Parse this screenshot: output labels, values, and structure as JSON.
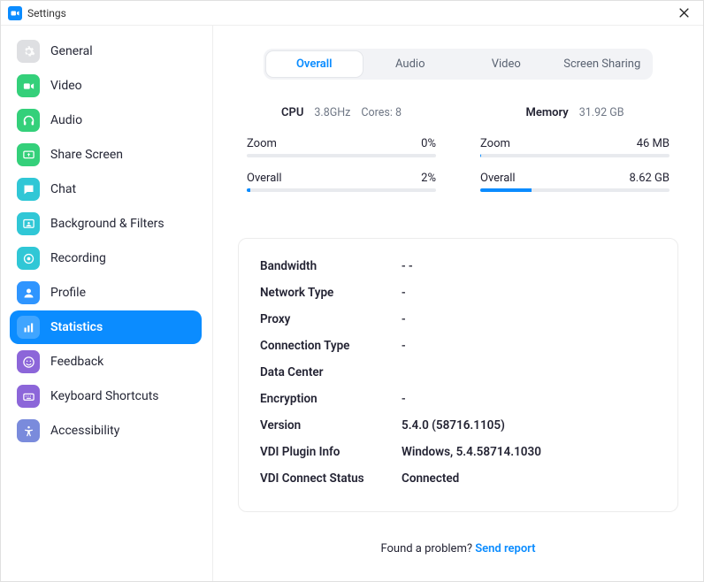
{
  "window": {
    "title": "Settings"
  },
  "sidebar": {
    "items": [
      {
        "id": "general",
        "label": "General",
        "icon": "gear-icon",
        "bg": "#dedfe2"
      },
      {
        "id": "video",
        "label": "Video",
        "icon": "video-icon",
        "bg": "#34d07a"
      },
      {
        "id": "audio",
        "label": "Audio",
        "icon": "headphones-icon",
        "bg": "#34d07a"
      },
      {
        "id": "share-screen",
        "label": "Share Screen",
        "icon": "share-screen-icon",
        "bg": "#34d07a"
      },
      {
        "id": "chat",
        "label": "Chat",
        "icon": "chat-icon",
        "bg": "#30c7d6"
      },
      {
        "id": "background",
        "label": "Background & Filters",
        "icon": "background-icon",
        "bg": "#30c7d6"
      },
      {
        "id": "recording",
        "label": "Recording",
        "icon": "recording-icon",
        "bg": "#30c7d6"
      },
      {
        "id": "profile",
        "label": "Profile",
        "icon": "profile-icon",
        "bg": "#2f95ff"
      },
      {
        "id": "statistics",
        "label": "Statistics",
        "icon": "statistics-icon",
        "bg": "#0b8cff",
        "active": true
      },
      {
        "id": "feedback",
        "label": "Feedback",
        "icon": "feedback-icon",
        "bg": "#8c66d9"
      },
      {
        "id": "shortcuts",
        "label": "Keyboard Shortcuts",
        "icon": "keyboard-icon",
        "bg": "#8c66d9"
      },
      {
        "id": "accessibility",
        "label": "Accessibility",
        "icon": "accessibility-icon",
        "bg": "#7a8bdc"
      }
    ]
  },
  "tabs": {
    "items": [
      {
        "label": "Overall",
        "active": true
      },
      {
        "label": "Audio"
      },
      {
        "label": "Video"
      },
      {
        "label": "Screen Sharing"
      }
    ]
  },
  "cpu": {
    "title": "CPU",
    "freq": "3.8GHz",
    "cores": "Cores: 8",
    "rows": [
      {
        "label": "Zoom",
        "value": "0%",
        "pct": 0
      },
      {
        "label": "Overall",
        "value": "2%",
        "pct": 2
      }
    ]
  },
  "memory": {
    "title": "Memory",
    "total": "31.92 GB",
    "rows": [
      {
        "label": "Zoom",
        "value": "46 MB",
        "pct": 0.2
      },
      {
        "label": "Overall",
        "value": "8.62 GB",
        "pct": 27
      }
    ]
  },
  "info": [
    {
      "k": "Bandwidth",
      "v": "-   -"
    },
    {
      "k": "Network Type",
      "v": "-"
    },
    {
      "k": "Proxy",
      "v": "-"
    },
    {
      "k": "Connection Type",
      "v": "-"
    },
    {
      "k": "Data Center",
      "v": ""
    },
    {
      "k": "Encryption",
      "v": "-"
    },
    {
      "k": "Version",
      "v": "5.4.0 (58716.1105)",
      "bold": true
    },
    {
      "k": "VDI Plugin Info",
      "v": "Windows, 5.4.58714.1030",
      "bold": true
    },
    {
      "k": "VDI Connect Status",
      "v": "Connected",
      "bold": true
    }
  ],
  "footer": {
    "text": "Found a problem? ",
    "link": "Send report"
  }
}
